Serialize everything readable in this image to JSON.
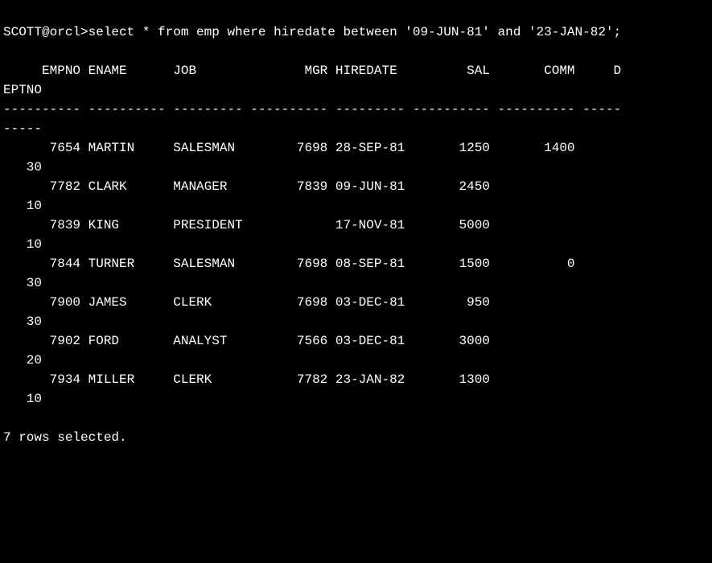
{
  "prompt": "SCOTT@orcl>",
  "command": "select * from emp where hiredate between '09-JUN-81' and '23-JAN-82';",
  "header_line_1": "     EMPNO ENAME      JOB              MGR HIREDATE         SAL       COMM     D",
  "header_line_2": "EPTNO",
  "separator_line_1": "---------- ---------- --------- ---------- --------- ---------- ---------- -----",
  "separator_line_2": "-----",
  "rows": [
    {
      "line1": "      7654 MARTIN     SALESMAN        7698 28-SEP-81       1250       1400",
      "line2": "   30"
    },
    {
      "line1": "      7782 CLARK      MANAGER         7839 09-JUN-81       2450",
      "line2": "   10"
    },
    {
      "line1": "      7839 KING       PRESIDENT            17-NOV-81       5000",
      "line2": "   10"
    },
    {
      "line1": "      7844 TURNER     SALESMAN        7698 08-SEP-81       1500          0",
      "line2": "   30"
    },
    {
      "line1": "      7900 JAMES      CLERK           7698 03-DEC-81        950",
      "line2": "   30"
    },
    {
      "line1": "      7902 FORD       ANALYST         7566 03-DEC-81       3000",
      "line2": "   20"
    },
    {
      "line1": "      7934 MILLER     CLERK           7782 23-JAN-82       1300",
      "line2": "   10"
    }
  ],
  "summary": "7 rows selected.",
  "chart_data": {
    "type": "table",
    "columns": [
      "EMPNO",
      "ENAME",
      "JOB",
      "MGR",
      "HIREDATE",
      "SAL",
      "COMM",
      "DEPTNO"
    ],
    "rows": [
      [
        7654,
        "MARTIN",
        "SALESMAN",
        7698,
        "28-SEP-81",
        1250,
        1400,
        30
      ],
      [
        7782,
        "CLARK",
        "MANAGER",
        7839,
        "09-JUN-81",
        2450,
        null,
        10
      ],
      [
        7839,
        "KING",
        "PRESIDENT",
        null,
        "17-NOV-81",
        5000,
        null,
        10
      ],
      [
        7844,
        "TURNER",
        "SALESMAN",
        7698,
        "08-SEP-81",
        1500,
        0,
        30
      ],
      [
        7900,
        "JAMES",
        "CLERK",
        7698,
        "03-DEC-81",
        950,
        null,
        30
      ],
      [
        7902,
        "FORD",
        "ANALYST",
        7566,
        "03-DEC-81",
        3000,
        null,
        20
      ],
      [
        7934,
        "MILLER",
        "CLERK",
        7782,
        "23-JAN-82",
        1300,
        null,
        10
      ]
    ]
  }
}
